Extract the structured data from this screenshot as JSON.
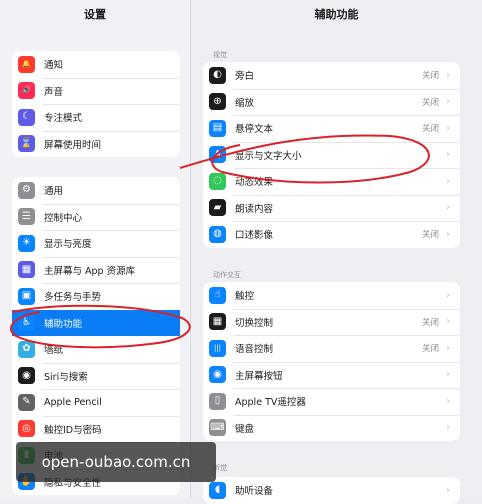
{
  "left_header": "设置",
  "right_header": "辅助功能",
  "left_groups": [
    [
      {
        "label": "通知",
        "icon": "bell-icon",
        "color": "#ff3b30",
        "glyph": "🔔"
      },
      {
        "label": "声音",
        "icon": "speaker-icon",
        "color": "#ff2d55",
        "glyph": "🔊"
      },
      {
        "label": "专注模式",
        "icon": "moon-icon",
        "color": "#5e5ce6",
        "glyph": "☾"
      },
      {
        "label": "屏幕使用时间",
        "icon": "hourglass-icon",
        "color": "#5e5ce6",
        "glyph": "⌛"
      }
    ],
    [
      {
        "label": "通用",
        "icon": "gear-icon",
        "color": "#8e8e93",
        "glyph": "⚙"
      },
      {
        "label": "控制中心",
        "icon": "toggles-icon",
        "color": "#8e8e93",
        "glyph": "☰"
      },
      {
        "label": "显示与亮度",
        "icon": "sun-icon",
        "color": "#0a84ff",
        "glyph": "☀"
      },
      {
        "label": "主屏幕与 App 资源库",
        "icon": "grid-icon",
        "color": "#5e5ce6",
        "glyph": "▦"
      },
      {
        "label": "多任务与手势",
        "icon": "multitask-icon",
        "color": "#0a84ff",
        "glyph": "▣"
      },
      {
        "label": "辅助功能",
        "icon": "accessibility-icon",
        "color": "#0a84ff",
        "glyph": "♿",
        "active": true
      },
      {
        "label": "墙纸",
        "icon": "flower-icon",
        "color": "#32ade6",
        "glyph": "✿"
      },
      {
        "label": "Siri与搜索",
        "icon": "siri-icon",
        "color": "#1c1c1e",
        "glyph": "◉"
      },
      {
        "label": "Apple Pencil",
        "icon": "pencil-icon",
        "color": "#636366",
        "glyph": "✎"
      },
      {
        "label": "触控ID与密码",
        "icon": "fingerprint-icon",
        "color": "#ff3b30",
        "glyph": "◎"
      },
      {
        "label": "电池",
        "icon": "battery-icon",
        "color": "#34c759",
        "glyph": "▮"
      },
      {
        "label": "隐私与安全性",
        "icon": "hand-icon",
        "color": "#0a84ff",
        "glyph": "✋"
      }
    ]
  ],
  "right_sections": [
    {
      "title": "视觉",
      "rows": [
        {
          "label": "旁白",
          "value": "关闭",
          "icon": "voiceover-icon",
          "color": "#1c1c1e",
          "glyph": "◐"
        },
        {
          "label": "缩放",
          "value": "关闭",
          "icon": "zoom-icon",
          "color": "#1c1c1e",
          "glyph": "⊕"
        },
        {
          "label": "悬停文本",
          "value": "关闭",
          "icon": "hover-text-icon",
          "color": "#0a84ff",
          "glyph": "▤"
        },
        {
          "label": "显示与文字大小",
          "value": "",
          "icon": "text-size-icon",
          "color": "#0a84ff",
          "glyph": "A"
        },
        {
          "label": "动态效果",
          "value": "",
          "icon": "motion-icon",
          "color": "#34c759",
          "glyph": "◌"
        },
        {
          "label": "朗读内容",
          "value": "",
          "icon": "speech-bubble-icon",
          "color": "#1c1c1e",
          "glyph": "▰"
        },
        {
          "label": "口述影像",
          "value": "关闭",
          "icon": "audio-description-icon",
          "color": "#0a84ff",
          "glyph": "◍"
        }
      ]
    },
    {
      "title": "动作交互",
      "rows": [
        {
          "label": "触控",
          "value": "",
          "icon": "touch-icon",
          "color": "#0a84ff",
          "glyph": "☝"
        },
        {
          "label": "切换控制",
          "value": "关闭",
          "icon": "switch-control-icon",
          "color": "#1c1c1e",
          "glyph": "▦"
        },
        {
          "label": "语音控制",
          "value": "关闭",
          "icon": "voice-control-icon",
          "color": "#0a84ff",
          "glyph": "|||"
        },
        {
          "label": "主屏幕按钮",
          "value": "",
          "icon": "home-button-icon",
          "color": "#0a84ff",
          "glyph": "◉"
        },
        {
          "label": "Apple TV遥控器",
          "value": "",
          "icon": "remote-icon",
          "color": "#8e8e93",
          "glyph": "▯"
        },
        {
          "label": "键盘",
          "value": "",
          "icon": "keyboard-icon",
          "color": "#8e8e93",
          "glyph": "⌨"
        }
      ]
    },
    {
      "title": "听觉",
      "rows": [
        {
          "label": "助听设备",
          "value": "",
          "icon": "ear-icon",
          "color": "#0a84ff",
          "glyph": "◖"
        }
      ]
    }
  ],
  "watermark": "open-oubao.com.cn",
  "annotation_color": "#d8232a"
}
